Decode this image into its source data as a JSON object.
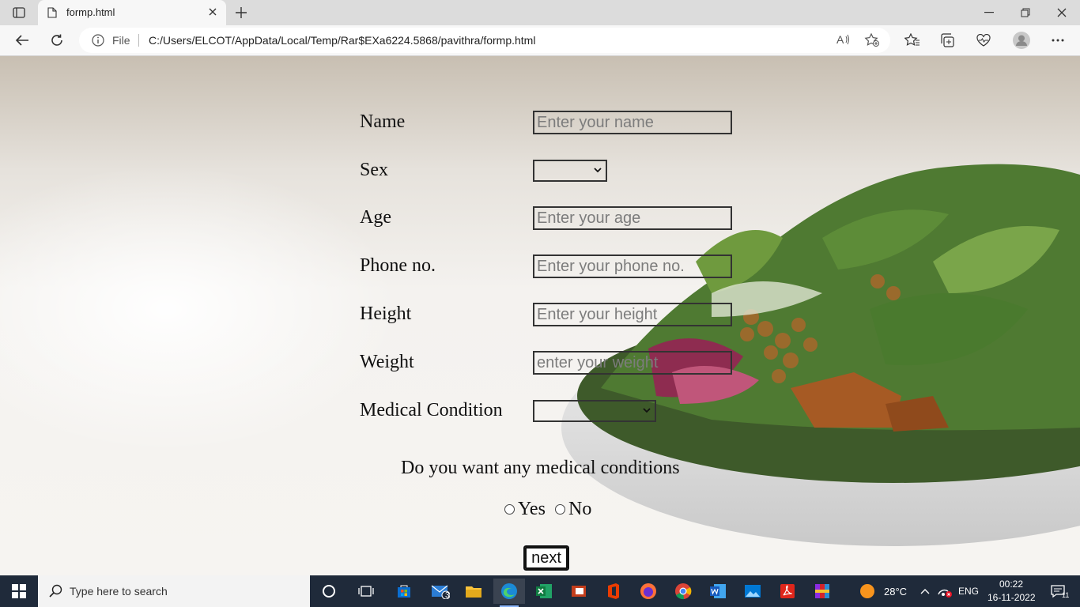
{
  "browser": {
    "tab_title": "formp.html",
    "address_prefix": "File",
    "url": "C:/Users/ELCOT/AppData/Local/Temp/Rar$EXa6224.5868/pavithra/formp.html",
    "read_aloud": "A⁾"
  },
  "form": {
    "name_label": "Name",
    "name_placeholder": "Enter your name",
    "sex_label": "Sex",
    "sex_value": "",
    "age_label": "Age",
    "age_placeholder": "Enter your age",
    "phone_label": "Phone no.",
    "phone_placeholder": "Enter your phone no.",
    "height_label": "Height",
    "height_placeholder": "Enter your height",
    "weight_label": "Weight",
    "weight_placeholder": "enter your weight",
    "medical_label": "Medical Condition",
    "medical_value": "",
    "question": "Do you want any medical conditions",
    "yes_label": "Yes",
    "no_label": "No",
    "next_label": "next"
  },
  "taskbar": {
    "search_placeholder": "Type here to search",
    "mail_badge": "3",
    "weather": "28°C",
    "language": "ENG",
    "time": "00:22",
    "date": "16-11-2022",
    "notification_count": "11"
  }
}
